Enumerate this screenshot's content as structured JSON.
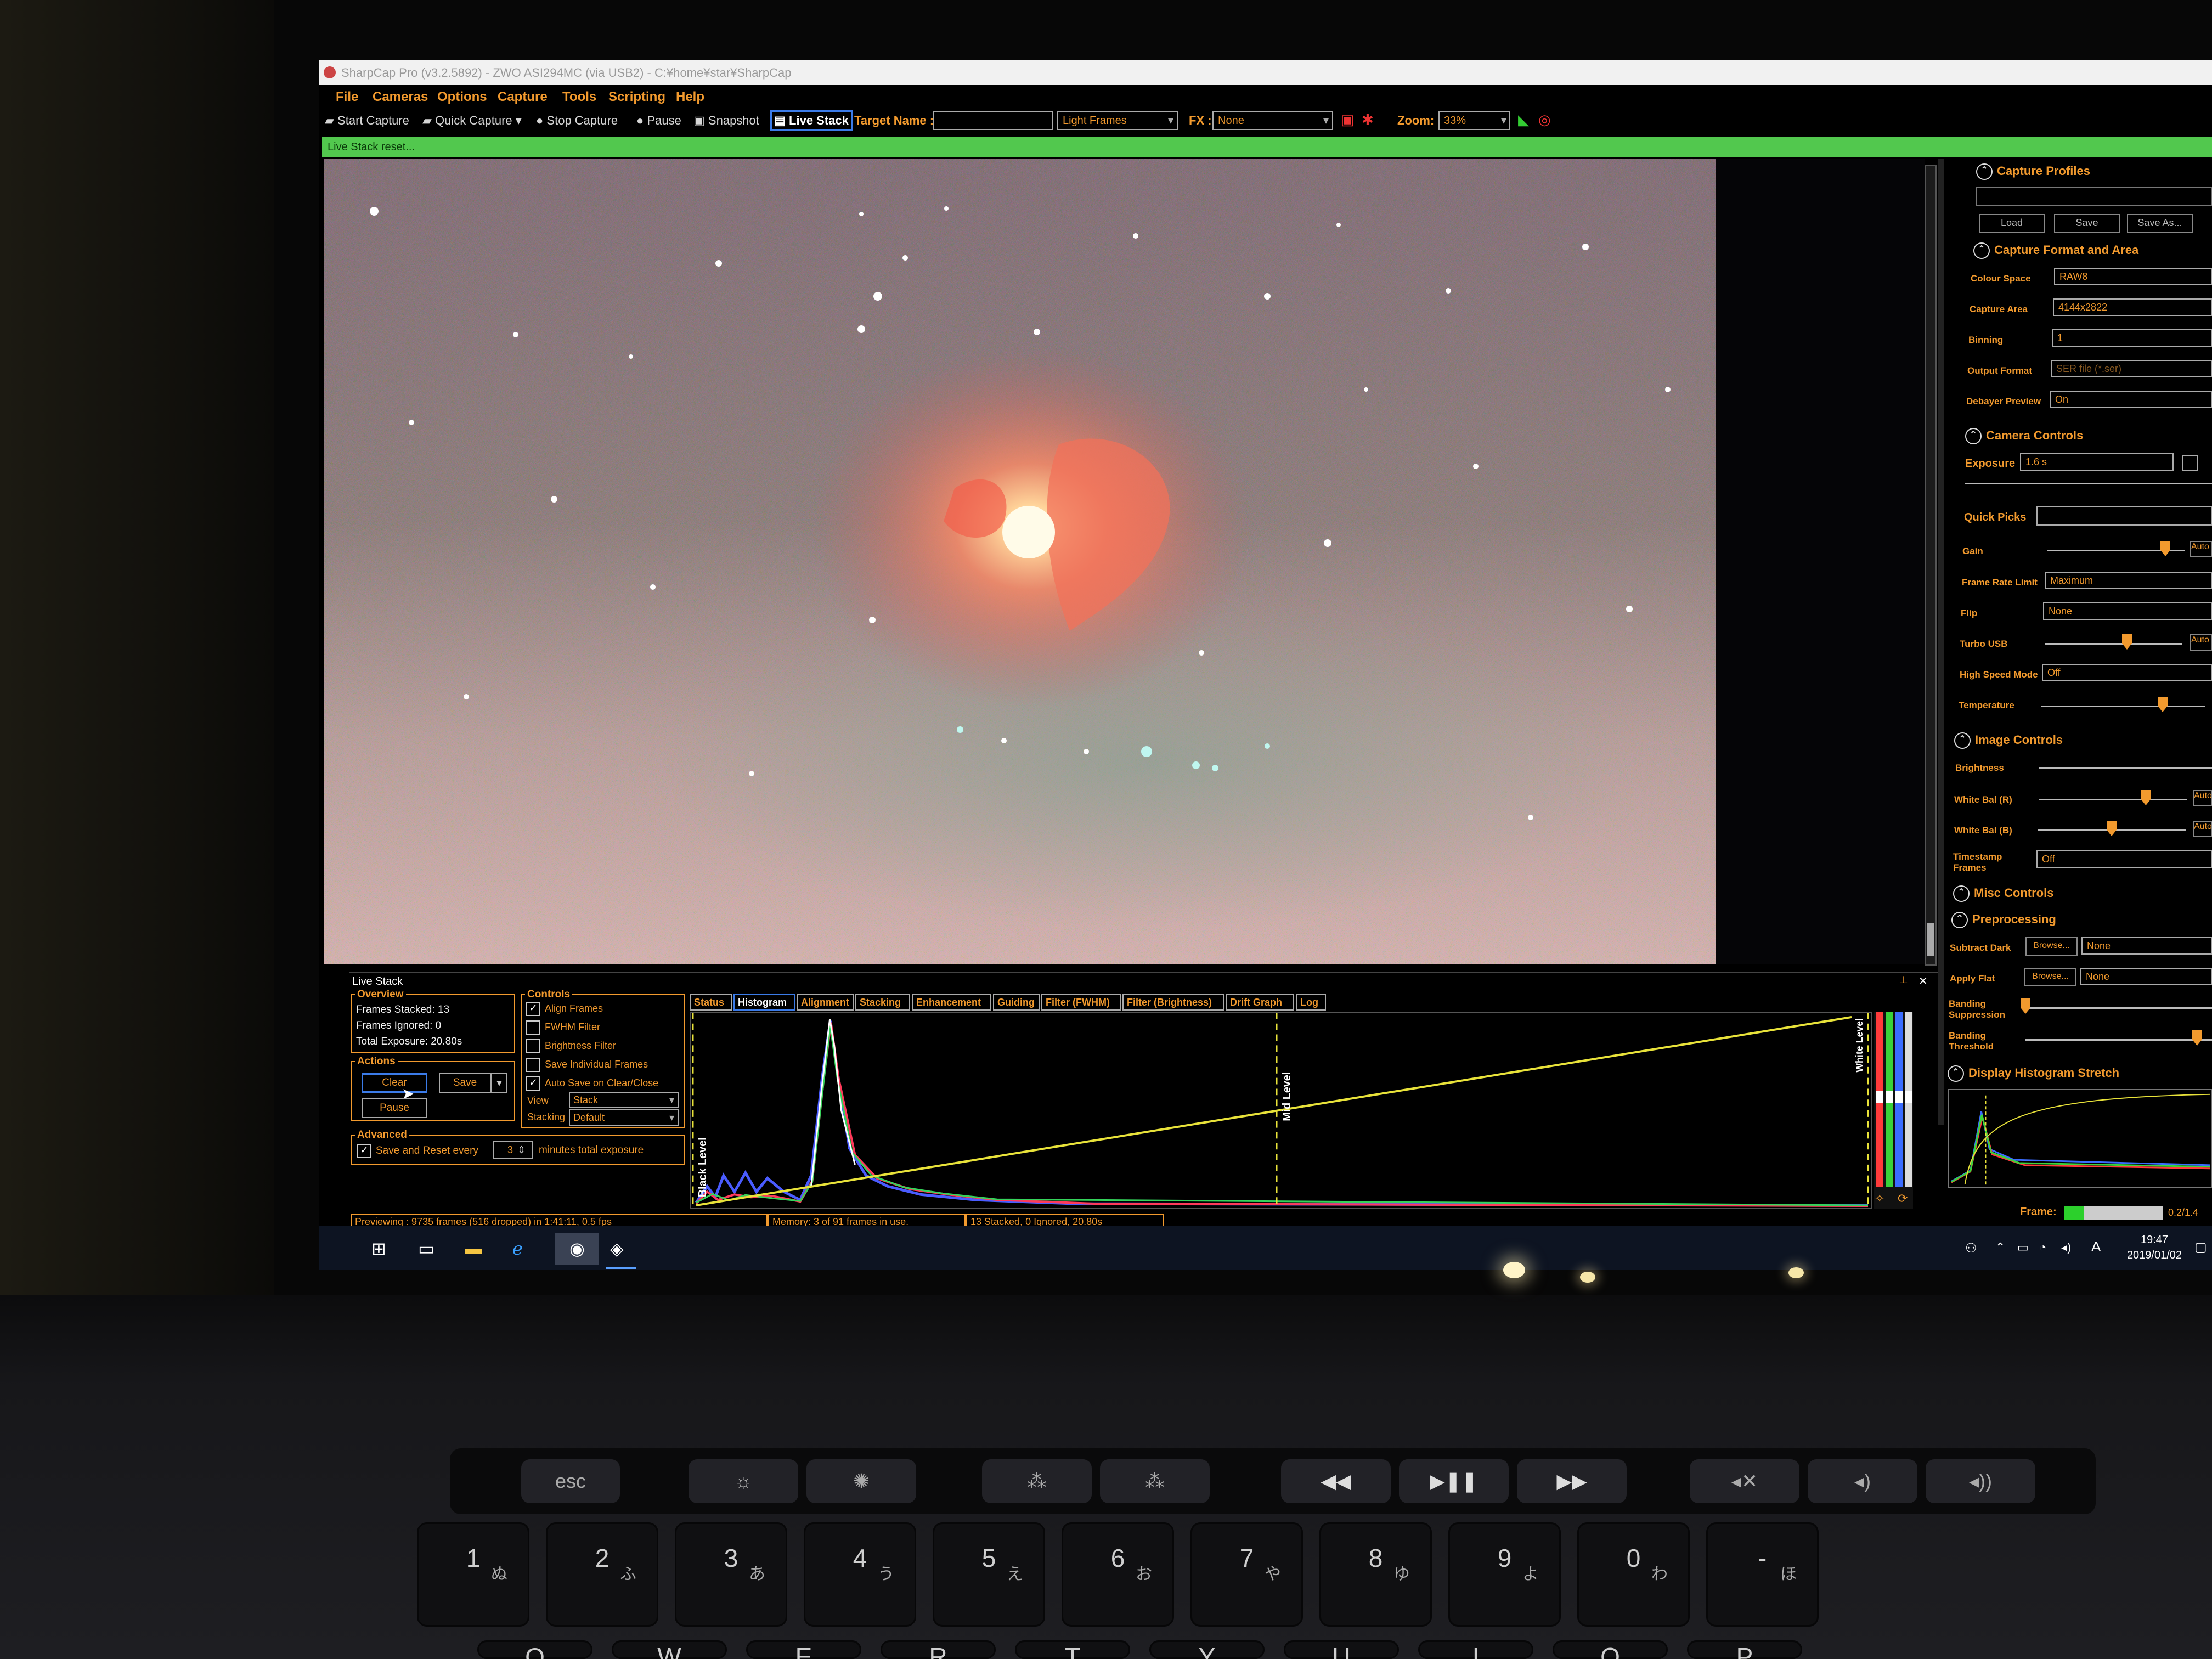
{
  "window": {
    "title": "SharpCap Pro (v3.2.5892) - ZWO ASI294MC (via USB2) - C:¥home¥star¥SharpCap"
  },
  "menu": [
    "File",
    "Cameras",
    "Options",
    "Capture",
    "Tools",
    "Scripting",
    "Help"
  ],
  "toolbar": {
    "start_capture": "Start Capture",
    "quick_capture": "Quick Capture",
    "stop_capture": "Stop Capture",
    "pause": "Pause",
    "snapshot": "Snapshot",
    "live_stack": "Live Stack",
    "target_name_label": "Target Name :",
    "target_name_value": "",
    "frame_type": "Light Frames",
    "fx_label": "FX :",
    "fx_value": "None",
    "zoom_label": "Zoom:",
    "zoom_value": "33%"
  },
  "status_banner": "Live Stack reset...",
  "right_panel": {
    "capture_profiles": {
      "title": "Capture Profiles",
      "buttons": [
        "Load",
        "Save",
        "Save As..."
      ]
    },
    "capture_format": {
      "title": "Capture Format and Area",
      "rows": [
        {
          "label": "Colour Space",
          "value": "RAW8"
        },
        {
          "label": "Capture Area",
          "value": "4144x2822"
        },
        {
          "label": "Binning",
          "value": "1"
        },
        {
          "label": "Output Format",
          "value": "SER file (*.ser)"
        },
        {
          "label": "Debayer Preview",
          "value": "On"
        }
      ]
    },
    "camera_controls": {
      "title": "Camera Controls",
      "exposure_label": "Exposure",
      "exposure_value": "1.6 s",
      "quick_picks_label": "Quick Picks",
      "gain_label": "Gain",
      "gain_level": 0.86,
      "gain_auto": "Auto",
      "frame_rate_label": "Frame Rate Limit",
      "frame_rate_value": "Maximum",
      "flip_label": "Flip",
      "flip_value": "None",
      "turbo_label": "Turbo USB",
      "turbo_level": 0.6,
      "turbo_auto": "Auto",
      "hsm_label": "High Speed Mode",
      "hsm_value": "Off",
      "temperature_label": "Temperature",
      "temperature_level": 0.74
    },
    "image_controls": {
      "title": "Image Controls",
      "brightness_label": "Brightness",
      "wb_r_label": "White Bal (R)",
      "wb_r_level": 0.72,
      "wb_r_auto": "Auto",
      "wb_b_label": "White Bal (B)",
      "wb_b_level": 0.5,
      "wb_b_auto": "Auto",
      "timestamp_label": "Timestamp Frames",
      "timestamp_value": "Off"
    },
    "misc_controls": {
      "title": "Misc Controls"
    },
    "preprocessing": {
      "title": "Preprocessing",
      "subtract_dark_label": "Subtract Dark",
      "subtract_dark_browse": "Browse...",
      "subtract_dark_value": "None",
      "apply_flat_label": "Apply Flat",
      "apply_flat_browse": "Browse...",
      "apply_flat_value": "None",
      "banding_suppression_label": "Banding Suppression",
      "banding_suppression_level": 0.0,
      "banding_threshold_label": "Banding Threshold",
      "banding_threshold_level": 0.92
    },
    "display_histogram": {
      "title": "Display Histogram Stretch"
    },
    "frame_label": "Frame:",
    "frame_value": "0.2/1.4"
  },
  "live_stack": {
    "title": "Live Stack",
    "overview": {
      "title": "Overview",
      "frames_stacked": "Frames Stacked: 13",
      "frames_ignored": "Frames Ignored: 0",
      "total_exposure": "Total Exposure: 20.80s"
    },
    "actions": {
      "title": "Actions",
      "clear": "Clear",
      "save": "Save",
      "pause": "Pause"
    },
    "advanced": {
      "title": "Advanced",
      "save_reset_label": "Save and Reset every",
      "save_reset_value": "3",
      "save_reset_suffix": "minutes total exposure"
    },
    "controls": {
      "title": "Controls",
      "checks": [
        {
          "label": "Align Frames",
          "checked": true
        },
        {
          "label": "FWHM Filter",
          "checked": false
        },
        {
          "label": "Brightness Filter",
          "checked": false
        },
        {
          "label": "Save Individual Frames",
          "checked": false
        },
        {
          "label": "Auto Save on Clear/Close",
          "checked": true
        }
      ],
      "view_label": "View",
      "view_value": "Stack",
      "stacking_label": "Stacking",
      "stacking_value": "Default"
    },
    "tabs": [
      "Status",
      "Histogram",
      "Alignment",
      "Stacking",
      "Enhancement",
      "Guiding",
      "Filter (FWHM)",
      "Filter (Brightness)",
      "Drift Graph",
      "Log"
    ],
    "active_tab": "Histogram",
    "histogram": {
      "black_level_label": "Black Level",
      "mid_level_label": "Mid Level",
      "white_level_label": "White Level"
    },
    "status_bar": {
      "preview": "Previewing : 9735 frames (516 dropped) in 1:41:11, 0.5 fps",
      "memory": "Memory: 3 of 91 frames in use.",
      "stacked": "13 Stacked, 0 Ignored, 20.80s"
    }
  },
  "taskbar": {
    "time": "19:47",
    "date": "2019/01/02",
    "ime": "A"
  },
  "keyboard": {
    "touchbar_esc": "esc",
    "number_row": [
      "1",
      "2",
      "3",
      "4",
      "5",
      "6",
      "7",
      "8",
      "9",
      "0",
      "-"
    ],
    "number_row_kana": [
      "ぬ",
      "ふ",
      "あ",
      "う",
      "え",
      "お",
      "や",
      "ゆ",
      "よ",
      "わ",
      "ほ"
    ],
    "letter_row": [
      "Q",
      "W",
      "E",
      "R",
      "T",
      "Y",
      "U",
      "I",
      "O",
      "P"
    ]
  },
  "colors": {
    "accent_orange": "#f29a2e",
    "banner_green": "#52c84e",
    "live_stack_blue": "#3b7be8",
    "histogram_yellow": "#e8e23a"
  }
}
